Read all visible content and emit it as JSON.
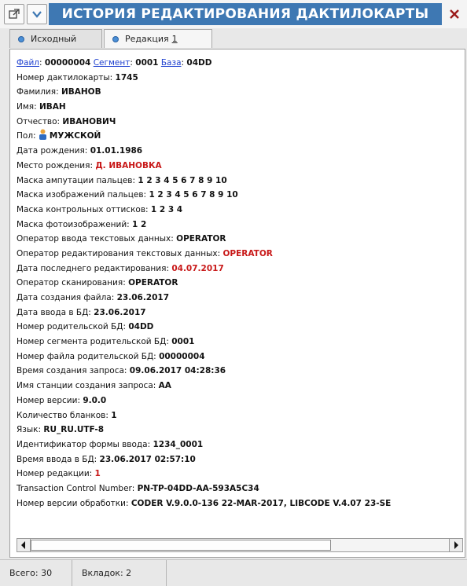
{
  "window": {
    "title": "ИСТОРИЯ РЕДАКТИРОВАНИЯ ДАКТИЛОКАРТЫ",
    "icons": [
      "external-window-icon",
      "chevron-down-icon",
      "close-icon"
    ]
  },
  "tabs": [
    {
      "label": "Исходный"
    },
    {
      "label": "Редакция",
      "number": "1",
      "active": true
    }
  ],
  "header_line": {
    "file_label": "Файл",
    "file_value": "00000004",
    "segment_label": "Сегмент",
    "segment_value": "0001",
    "base_label": "База",
    "base_value": "04DD"
  },
  "fields": [
    {
      "label": "Номер дактилокарты: ",
      "value": "1745"
    },
    {
      "label": "Фамилия: ",
      "value": "ИВАНОВ"
    },
    {
      "label": "Имя: ",
      "value": "ИВАН"
    },
    {
      "label": "Отчество: ",
      "value": "ИВАНОВИЧ"
    },
    {
      "label": "Пол: ",
      "value": "МУЖСКОЙ",
      "icon": "person-icon"
    },
    {
      "label": "Дата рождения: ",
      "value": "01.01.1986"
    },
    {
      "label": "Место рождения: ",
      "value": "Д. ИВАНОВКА",
      "changed": true
    },
    {
      "label": "Маска ампутации пальцев: ",
      "value": "1 2 3 4 5 6 7 8 9 10"
    },
    {
      "label": "Маска изображений пальцев: ",
      "value": "1 2 3 4 5 6 7 8 9 10"
    },
    {
      "label": "Маска контрольных оттисков: ",
      "value": "1 2 3 4"
    },
    {
      "label": "Маска фотоизображений: ",
      "value": "1 2"
    },
    {
      "label": "Оператор ввода текстовых данных: ",
      "value": "OPERATOR"
    },
    {
      "label": "Оператор редактирования текстовых данных: ",
      "value": "OPERATOR",
      "changed": true
    },
    {
      "label": "Дата последнего редактирования: ",
      "value": "04.07.2017",
      "changed": true
    },
    {
      "label": "Оператор сканирования: ",
      "value": "OPERATOR"
    },
    {
      "label": "Дата создания файла: ",
      "value": "23.06.2017"
    },
    {
      "label": "Дата ввода в БД: ",
      "value": "23.06.2017"
    },
    {
      "label": "Номер родительской БД: ",
      "value": "04DD"
    },
    {
      "label": "Номер сегмента родительской БД: ",
      "value": "0001"
    },
    {
      "label": "Номер файла родительской БД: ",
      "value": "00000004"
    },
    {
      "label": "Время создания запроса: ",
      "value": "09.06.2017 04:28:36"
    },
    {
      "label": "Имя станции создания запроса: ",
      "value": "AA"
    },
    {
      "label": "Номер версии: ",
      "value": "9.0.0"
    },
    {
      "label": "Количество бланков: ",
      "value": "1"
    },
    {
      "label": "Язык: ",
      "value": "RU_RU.UTF-8"
    },
    {
      "label": "Идентификатор формы ввода: ",
      "value": "1234_0001"
    },
    {
      "label": "Время ввода в БД: ",
      "value": "23.06.2017 02:57:10"
    },
    {
      "label": "Номер редакции: ",
      "value": "1",
      "changed": true
    },
    {
      "label": "Transaction Control Number: ",
      "value": "PN-TP-04DD-AA-593A5C34"
    },
    {
      "label": "Номер версии обработки: ",
      "value": "CODER V.9.0.0-136 22-MAR-2017, LIBCODE V.4.07 23-SE"
    }
  ],
  "status": {
    "total": "Всего: 30",
    "tabs_count": "Вкладок: 2"
  },
  "colors": {
    "title_bar": "#3e78b3",
    "changed_value": "#c81818",
    "link": "#1d3fcf",
    "tab_dot": "#4a8fd6"
  }
}
